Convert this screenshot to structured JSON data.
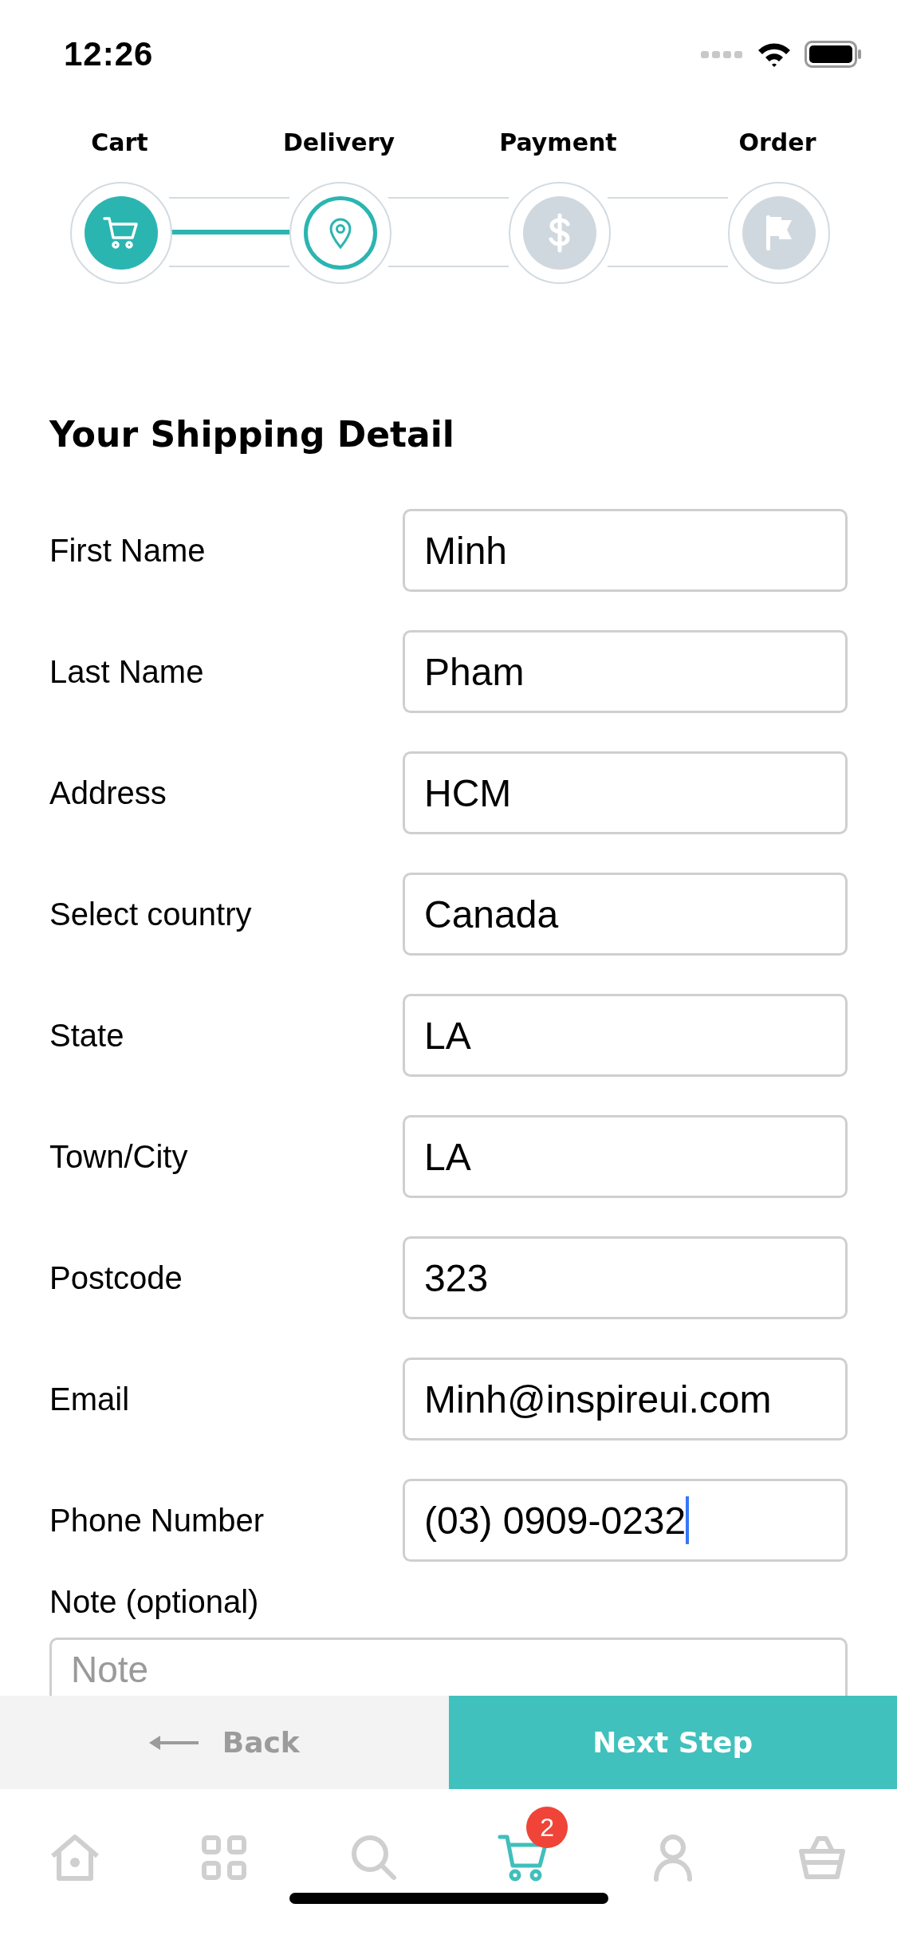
{
  "status_bar": {
    "time": "12:26"
  },
  "steps": [
    {
      "label": "Cart",
      "done": true,
      "selected": false
    },
    {
      "label": "Delivery",
      "done": false,
      "selected": true
    },
    {
      "label": "Payment",
      "done": false,
      "selected": false
    },
    {
      "label": "Order",
      "done": false,
      "selected": false
    }
  ],
  "title": "Your Shipping Detail",
  "fields": [
    {
      "label": "First Name",
      "value": "Minh",
      "focused": false
    },
    {
      "label": "Last Name",
      "value": "Pham",
      "focused": false
    },
    {
      "label": "Address",
      "value": "HCM",
      "focused": false
    },
    {
      "label": "Select country",
      "value": "Canada",
      "focused": false
    },
    {
      "label": "State",
      "value": "LA",
      "focused": false
    },
    {
      "label": "Town/City",
      "value": "LA",
      "focused": false
    },
    {
      "label": "Postcode",
      "value": "323",
      "focused": false
    },
    {
      "label": "Email",
      "value": "Minh@inspireui.com",
      "focused": false
    },
    {
      "label": "Phone Number",
      "value": "(03) 0909-0232",
      "focused": true
    }
  ],
  "note": {
    "label": "Note (optional)",
    "placeholder": "Note"
  },
  "actions": {
    "back": "Back",
    "next": "Next Step"
  },
  "tab_bar": [
    {
      "selected": false
    },
    {
      "selected": false
    },
    {
      "selected": false
    },
    {
      "selected": true,
      "badge": "2"
    },
    {
      "selected": false
    },
    {
      "selected": false
    }
  ]
}
